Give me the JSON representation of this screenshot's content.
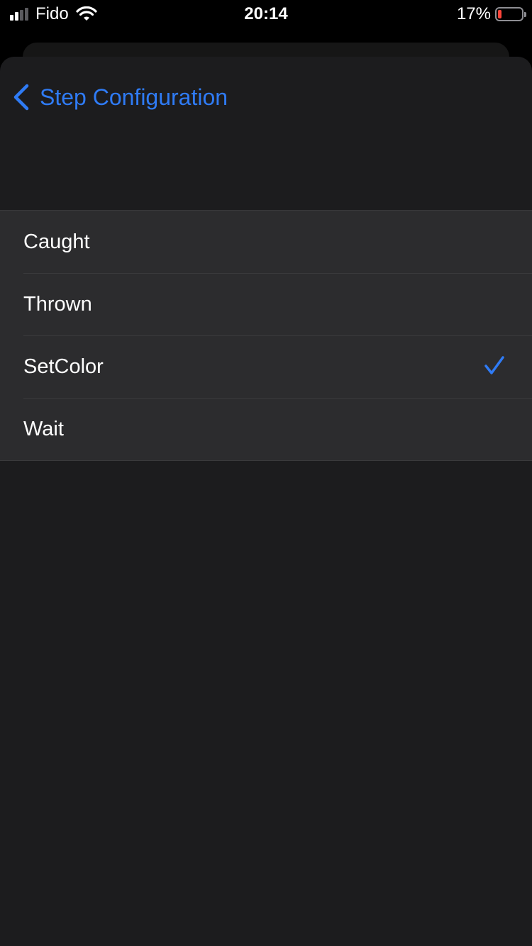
{
  "status_bar": {
    "carrier": "Fido",
    "time": "20:14",
    "battery_percent": "17%",
    "battery_level": 0.17,
    "signal_bars": 4,
    "signal_active": 2,
    "battery_color": "#ff453a"
  },
  "nav": {
    "back_label": "Step Configuration",
    "back_icon": "chevron-left-icon",
    "accent_color": "#2f7bf5"
  },
  "options": [
    {
      "label": "Caught",
      "selected": false
    },
    {
      "label": "Thrown",
      "selected": false
    },
    {
      "label": "SetColor",
      "selected": true
    },
    {
      "label": "Wait",
      "selected": false
    }
  ],
  "selected_icon": "checkmark-icon"
}
